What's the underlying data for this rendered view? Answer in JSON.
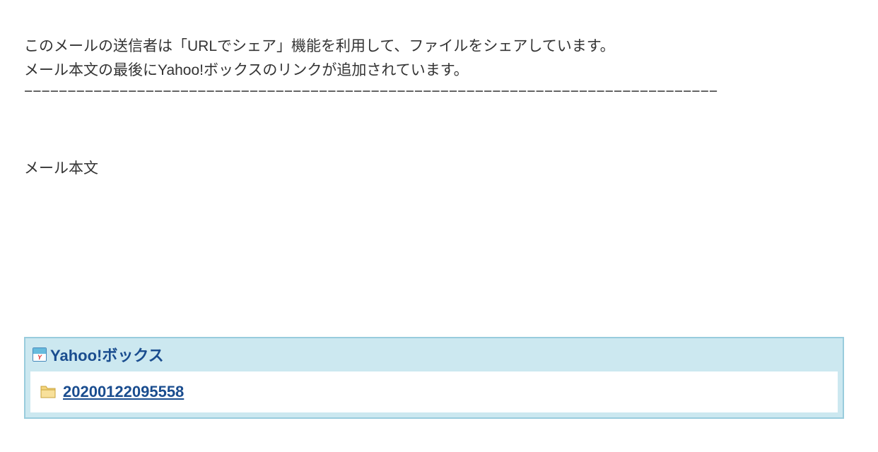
{
  "header": {
    "line1": "このメールの送信者は「URLでシェア」機能を利用して、ファイルをシェアしています。",
    "line2": "メール本文の最後にYahoo!ボックスのリンクが追加されています。",
    "divider": "−−−−−−−−−−−−−−−−−−−−−−−−−−−−−−−−−−−−−−−−−−−−−−−−−−−−−−−−−−−−−−−−−−−−−−−−−−−−−−−−"
  },
  "body": {
    "label": "メール本文"
  },
  "yahoo_box": {
    "icon_letter": "Y",
    "title": "Yahoo!ボックス",
    "file_name": "20200122095558"
  }
}
